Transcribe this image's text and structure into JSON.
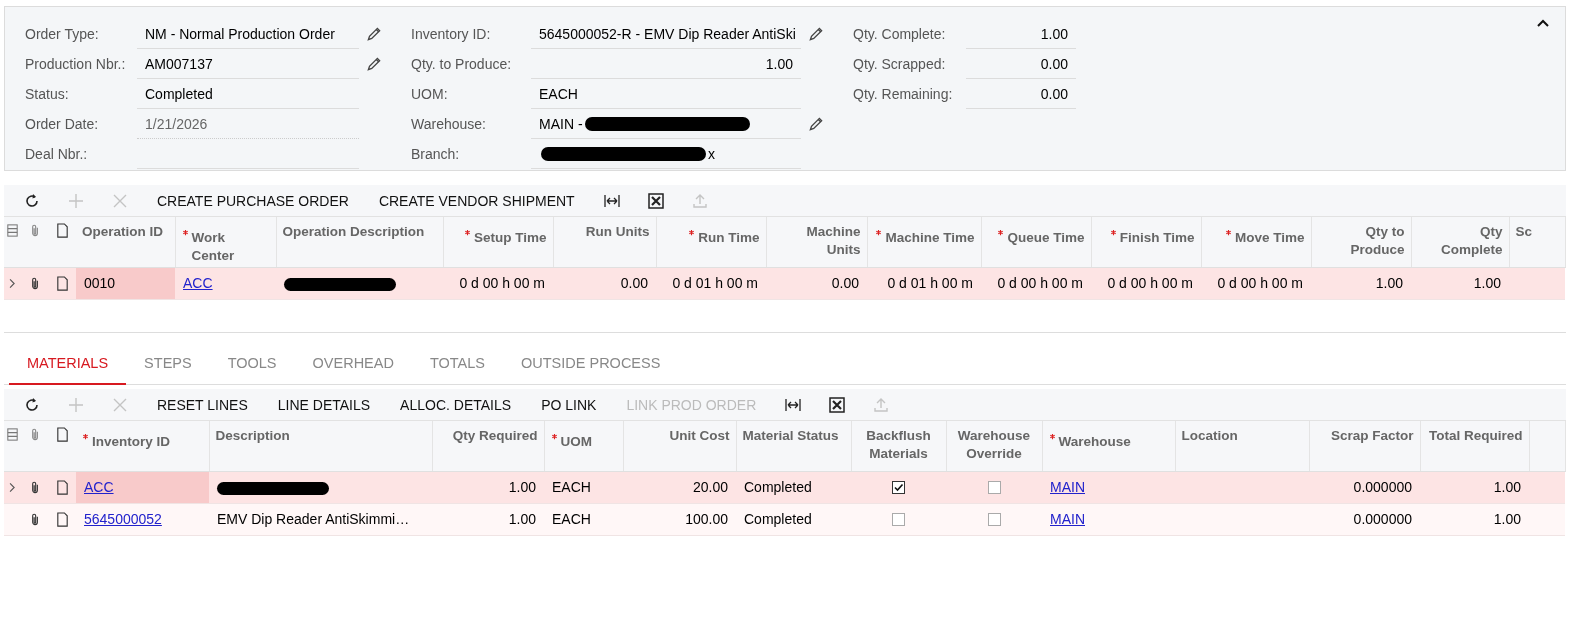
{
  "summary": {
    "columns": [
      {
        "fields": [
          {
            "label": "Order Type:",
            "value": "NM - Normal Production Order",
            "kind": "text",
            "disabled": false,
            "edit_icon": true
          },
          {
            "label": "Production Nbr.:",
            "value": "AM007137",
            "kind": "text",
            "disabled": false,
            "edit_icon": true
          },
          {
            "label": "Status:",
            "value": "Completed",
            "kind": "text",
            "disabled": false,
            "edit_icon": false
          },
          {
            "label": "Order Date:",
            "value": "1/21/2026",
            "kind": "text",
            "disabled": true,
            "edit_icon": false
          },
          {
            "label": "Deal Nbr.:",
            "kind": "text",
            "disabled": false,
            "edit_icon": false
          }
        ]
      },
      {
        "fields": [
          {
            "label": "Inventory ID:",
            "value": "5645000052-R - EMV Dip Reader AntiSki",
            "kind": "text",
            "disabled": false,
            "edit_icon": true
          },
          {
            "label": "Qty. to Produce:",
            "value": "1.00",
            "kind": "number",
            "disabled": false,
            "edit_icon": false
          },
          {
            "label": "UOM:",
            "value": "EACH",
            "kind": "text",
            "disabled": false,
            "edit_icon": false
          },
          {
            "label": "Warehouse:",
            "value": "MAIN -",
            "kind": "redacted_end",
            "disabled": false,
            "edit_icon": true
          },
          {
            "label": "Branch:",
            "value": "x",
            "kind": "redacted_start",
            "disabled": false,
            "edit_icon": false
          }
        ]
      },
      {
        "fields": [
          {
            "label": "Qty. Complete:",
            "value": "1.00",
            "kind": "number",
            "disabled": false,
            "edit_icon": false
          },
          {
            "label": "Qty. Scrapped:",
            "value": "0.00",
            "kind": "number",
            "disabled": false,
            "edit_icon": false
          },
          {
            "label": "Qty. Remaining:",
            "value": "0.00",
            "kind": "number",
            "disabled": false,
            "edit_icon": false
          }
        ]
      }
    ]
  },
  "operations": {
    "toolbar": [
      {
        "kind": "icon",
        "disabled": false
      },
      {
        "kind": "icon",
        "disabled": true
      },
      {
        "kind": "icon",
        "disabled": true
      },
      {
        "kind": "text",
        "label": "CREATE PURCHASE ORDER",
        "disabled": false
      },
      {
        "kind": "text",
        "label": "CREATE VENDOR SHIPMENT",
        "disabled": false
      },
      {
        "kind": "icon",
        "disabled": false
      },
      {
        "kind": "icon",
        "disabled": false
      },
      {
        "kind": "icon",
        "disabled": true
      }
    ],
    "columns": [
      {
        "label": "Operation ID",
        "required": false,
        "kind": "text"
      },
      {
        "label": "Work Center",
        "required": true,
        "kind": "text"
      },
      {
        "label": "Operation Description",
        "required": false,
        "kind": "text"
      },
      {
        "label": "Setup Time",
        "required": true,
        "kind": "number"
      },
      {
        "label": "Run Units",
        "required": false,
        "kind": "number"
      },
      {
        "label": "Run Time",
        "required": true,
        "kind": "number"
      },
      {
        "label": "Machine Units",
        "required": false,
        "kind": "number"
      },
      {
        "label": "Machine Time",
        "required": true,
        "kind": "number"
      },
      {
        "label": "Queue Time",
        "required": true,
        "kind": "number"
      },
      {
        "label": "Finish Time",
        "required": true,
        "kind": "number"
      },
      {
        "label": "Move Time",
        "required": true,
        "kind": "number"
      },
      {
        "label": "Qty to Produce",
        "required": false,
        "kind": "number"
      },
      {
        "label": "Qty Complete",
        "required": false,
        "kind": "number"
      },
      {
        "label": "Sc",
        "required": false,
        "kind": "text"
      }
    ],
    "rows": [
      {
        "selected": true,
        "cells": [
          {
            "kind": "text",
            "value": "0010"
          },
          {
            "kind": "link",
            "value": "ACC"
          },
          {
            "kind": "redacted"
          },
          {
            "kind": "text",
            "value": "0 d 00 h 00 m"
          },
          {
            "kind": "text",
            "value": "0.00"
          },
          {
            "kind": "text",
            "value": "0 d 01 h 00 m"
          },
          {
            "kind": "text",
            "value": "0.00"
          },
          {
            "kind": "text",
            "value": "0 d 01 h 00 m"
          },
          {
            "kind": "text",
            "value": "0 d 00 h 00 m"
          },
          {
            "kind": "text",
            "value": "0 d 00 h 00 m"
          },
          {
            "kind": "text",
            "value": "0 d 00 h 00 m"
          },
          {
            "kind": "text",
            "value": "1.00"
          },
          {
            "kind": "text",
            "value": "1.00"
          }
        ]
      }
    ]
  },
  "tabs": [
    {
      "label": "MATERIALS",
      "selected": true
    },
    {
      "label": "STEPS",
      "selected": false
    },
    {
      "label": "TOOLS",
      "selected": false
    },
    {
      "label": "OVERHEAD",
      "selected": false
    },
    {
      "label": "TOTALS",
      "selected": false
    },
    {
      "label": "OUTSIDE PROCESS",
      "selected": false
    }
  ],
  "materials": {
    "toolbar": [
      {
        "kind": "icon",
        "disabled": false
      },
      {
        "kind": "icon",
        "disabled": true
      },
      {
        "kind": "icon",
        "disabled": true
      },
      {
        "kind": "text",
        "label": "RESET LINES",
        "disabled": false
      },
      {
        "kind": "text",
        "label": "LINE DETAILS",
        "disabled": false
      },
      {
        "kind": "text",
        "label": "ALLOC. DETAILS",
        "disabled": false
      },
      {
        "kind": "text",
        "label": "PO LINK",
        "disabled": false
      },
      {
        "kind": "text",
        "label": "LINK PROD ORDER",
        "disabled": true
      },
      {
        "kind": "icon",
        "disabled": false
      },
      {
        "kind": "icon",
        "disabled": false
      },
      {
        "kind": "icon",
        "disabled": true
      }
    ],
    "columns": [
      {
        "label": "Inventory ID",
        "required": true,
        "kind": "text"
      },
      {
        "label": "Description",
        "required": false,
        "kind": "text"
      },
      {
        "label": "Qty Required",
        "required": false,
        "kind": "number"
      },
      {
        "label": "UOM",
        "required": true,
        "kind": "text"
      },
      {
        "label": "Unit Cost",
        "required": false,
        "kind": "number"
      },
      {
        "label": "Material Status",
        "required": false,
        "kind": "text"
      },
      {
        "label": "Backflush Materials",
        "required": false,
        "kind": "check"
      },
      {
        "label": "Warehouse Override",
        "required": false,
        "kind": "check"
      },
      {
        "label": "Warehouse",
        "required": true,
        "kind": "text"
      },
      {
        "label": "Location",
        "required": false,
        "kind": "text"
      },
      {
        "label": "Scrap Factor",
        "required": false,
        "kind": "number"
      },
      {
        "label": "Total Required",
        "required": false,
        "kind": "number"
      }
    ],
    "rows": [
      {
        "selected": true,
        "cells": [
          {
            "kind": "link",
            "value": "ACC"
          },
          {
            "kind": "redacted"
          },
          {
            "kind": "text",
            "value": "1.00"
          },
          {
            "kind": "text",
            "value": "EACH"
          },
          {
            "kind": "text",
            "value": "20.00"
          },
          {
            "kind": "text",
            "value": "Completed"
          },
          {
            "kind": "check",
            "checked": true
          },
          {
            "kind": "check",
            "checked": false
          },
          {
            "kind": "link",
            "value": "MAIN"
          },
          {
            "kind": "blank"
          },
          {
            "kind": "text",
            "value": "0.000000"
          },
          {
            "kind": "text",
            "value": "1.00"
          }
        ]
      },
      {
        "selected": false,
        "cells": [
          {
            "kind": "link",
            "value": "5645000052"
          },
          {
            "kind": "text",
            "value": "EMV Dip Reader AntiSkimmi…"
          },
          {
            "kind": "text",
            "value": "1.00"
          },
          {
            "kind": "text",
            "value": "EACH"
          },
          {
            "kind": "text",
            "value": "100.00"
          },
          {
            "kind": "text",
            "value": "Completed"
          },
          {
            "kind": "check",
            "checked": false
          },
          {
            "kind": "check",
            "checked": false
          },
          {
            "kind": "link",
            "value": "MAIN"
          },
          {
            "kind": "blank"
          },
          {
            "kind": "text",
            "value": "0.000000"
          },
          {
            "kind": "text",
            "value": "1.00"
          }
        ]
      }
    ]
  }
}
